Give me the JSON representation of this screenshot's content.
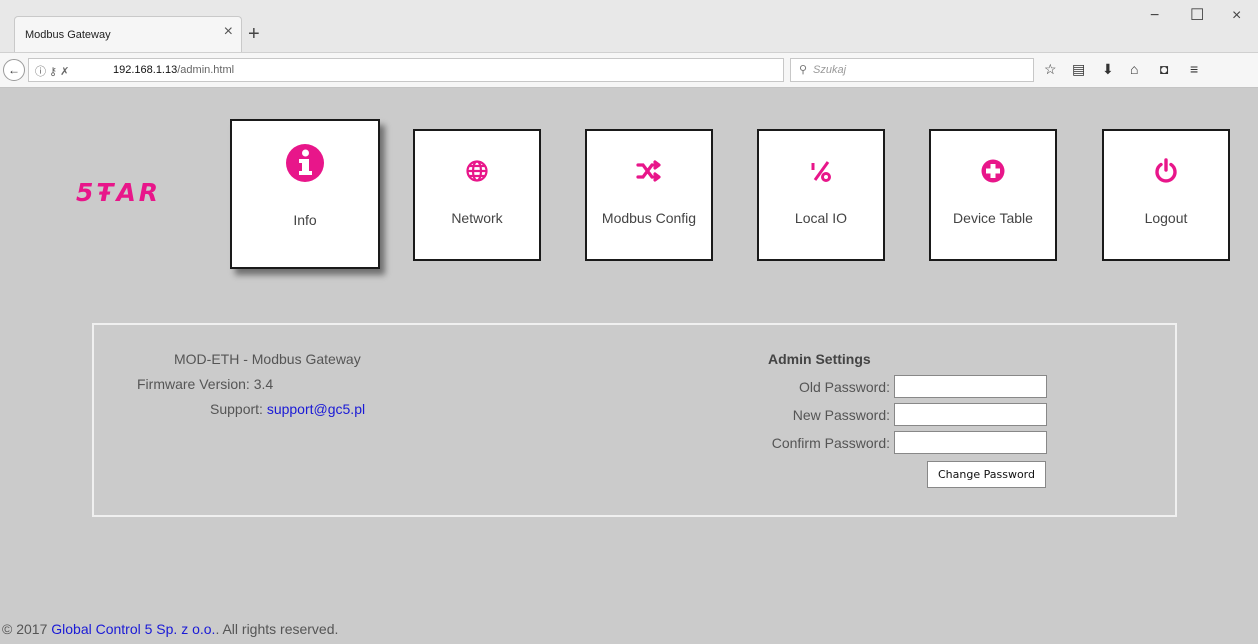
{
  "browser": {
    "tab_title": "Modbus Gateway",
    "tab_close": "×",
    "new_tab": "+",
    "url_host": "192.168.1.13",
    "url_path": "/admin.html",
    "search_placeholder": "Szukaj",
    "window_minimize": "−",
    "window_maximize": "☐",
    "window_close": "×"
  },
  "logo": {
    "text": "5ŦAR"
  },
  "nav": [
    {
      "label": "Info",
      "icon": "info-icon",
      "active": true
    },
    {
      "label": "Network",
      "icon": "globe-icon",
      "active": false
    },
    {
      "label": "Modbus Config",
      "icon": "shuffle-icon",
      "active": false
    },
    {
      "label": "Local IO",
      "icon": "percent-icon",
      "active": false
    },
    {
      "label": "Device Table",
      "icon": "plus-circle-icon",
      "active": false
    },
    {
      "label": "Logout",
      "icon": "power-icon",
      "active": false
    }
  ],
  "device": {
    "name": "MOD-ETH - Modbus Gateway",
    "firmware_label": "Firmware Version:",
    "firmware_value": "3.4",
    "support_label": "Support:",
    "support_email": "support@gc5.pl"
  },
  "admin": {
    "title": "Admin Settings",
    "old_password_label": "Old Password:",
    "new_password_label": "New Password:",
    "confirm_password_label": "Confirm Password:",
    "old_password_value": "",
    "new_password_value": "",
    "confirm_password_value": "",
    "change_button": "Change Password"
  },
  "footer": {
    "prefix": "© 2017 ",
    "company": "Global Control 5 Sp. z o.o.",
    "suffix": ". All rights reserved."
  },
  "colors": {
    "accent": "#e8168a",
    "link": "#1a1ad6",
    "background": "#cbcbcb"
  }
}
